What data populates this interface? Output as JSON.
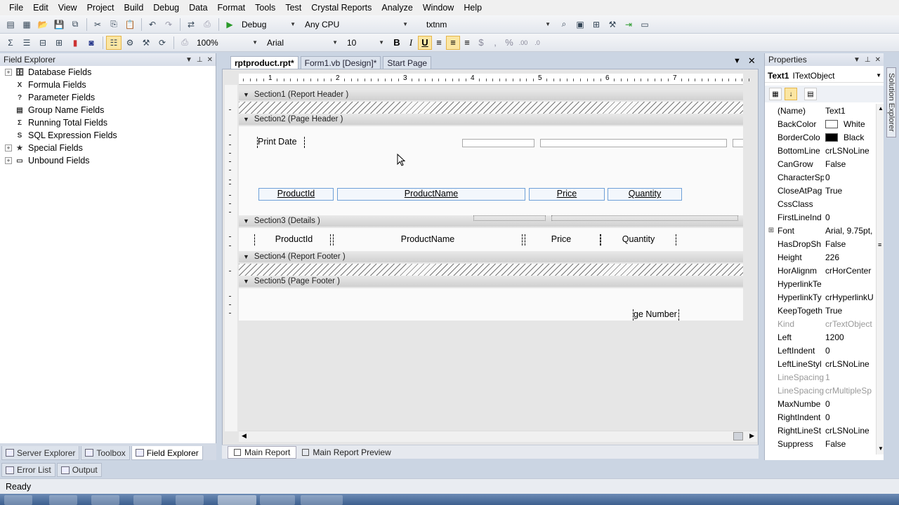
{
  "menu": [
    "File",
    "Edit",
    "View",
    "Project",
    "Build",
    "Debug",
    "Data",
    "Format",
    "Tools",
    "Test",
    "Crystal Reports",
    "Analyze",
    "Window",
    "Help"
  ],
  "toolbar1": {
    "config": "Debug",
    "platform": "Any CPU",
    "find": "txtnm"
  },
  "toolbar2": {
    "zoom": "100%",
    "font": "Arial",
    "size": "10",
    "bold": "B",
    "italic": "I",
    "underline": "U"
  },
  "field_explorer": {
    "title": "Field Explorer",
    "items": [
      {
        "label": "Database Fields",
        "expandable": true,
        "icon": "database-icon"
      },
      {
        "label": "Formula Fields",
        "expandable": false,
        "icon": "formula-icon"
      },
      {
        "label": "Parameter Fields",
        "expandable": false,
        "icon": "parameter-icon"
      },
      {
        "label": "Group Name Fields",
        "expandable": false,
        "icon": "group-icon"
      },
      {
        "label": "Running Total Fields",
        "expandable": false,
        "icon": "sigma-icon"
      },
      {
        "label": "SQL Expression Fields",
        "expandable": false,
        "icon": "sql-icon"
      },
      {
        "label": "Special Fields",
        "expandable": true,
        "icon": "special-icon"
      },
      {
        "label": "Unbound Fields",
        "expandable": true,
        "icon": "unbound-icon"
      }
    ]
  },
  "left_tabs": [
    "Server Explorer",
    "Toolbox",
    "Field Explorer"
  ],
  "bottom_tabs": [
    "Error List",
    "Output"
  ],
  "doc_tabs": [
    "rptproduct.rpt*",
    "Form1.vb [Design]*",
    "Start Page"
  ],
  "ruler": [
    "1",
    "2",
    "3",
    "4",
    "5",
    "6",
    "7"
  ],
  "sections": {
    "s1": "Section1 (Report Header  )",
    "s2": "Section2 (Page Header  )",
    "s3": "Section3 (Details  )",
    "s4": "Section4 (Report Footer  )",
    "s5": "Section5 (Page Footer  )"
  },
  "report": {
    "print_date": "Print Date",
    "headers": [
      "ProductId",
      "ProductName",
      "Price",
      "Quantity"
    ],
    "details": [
      "ProductId",
      "ProductName",
      "Price",
      "Quantity"
    ],
    "page_number": "ge Number"
  },
  "report_tabs": [
    "Main Report",
    "Main Report Preview"
  ],
  "properties": {
    "title": "Properties",
    "object_name": "Text1",
    "object_type": "ITextObject",
    "rows": [
      {
        "name": "(Name)",
        "value": "Text1"
      },
      {
        "name": "BackColor",
        "value": "White",
        "swatch": "#ffffff"
      },
      {
        "name": "BorderColo",
        "value": "Black",
        "swatch": "#000000"
      },
      {
        "name": "BottomLine",
        "value": "crLSNoLine"
      },
      {
        "name": "CanGrow",
        "value": "False"
      },
      {
        "name": "CharacterSp",
        "value": "0"
      },
      {
        "name": "CloseAtPag",
        "value": "True"
      },
      {
        "name": "CssClass",
        "value": ""
      },
      {
        "name": "FirstLineInd",
        "value": "0"
      },
      {
        "name": "Font",
        "value": "Arial, 9.75pt,",
        "expandable": true
      },
      {
        "name": "HasDropSh",
        "value": "False"
      },
      {
        "name": "Height",
        "value": "226"
      },
      {
        "name": "HorAlignm",
        "value": "crHorCenter"
      },
      {
        "name": "HyperlinkTe",
        "value": ""
      },
      {
        "name": "HyperlinkTy",
        "value": "crHyperlinkU"
      },
      {
        "name": "KeepTogeth",
        "value": "True"
      },
      {
        "name": "Kind",
        "value": "crTextObject",
        "dim": true
      },
      {
        "name": "Left",
        "value": "1200"
      },
      {
        "name": "LeftIndent",
        "value": "0"
      },
      {
        "name": "LeftLineStyl",
        "value": "crLSNoLine"
      },
      {
        "name": "LineSpacing",
        "value": "1",
        "dim": true
      },
      {
        "name": "LineSpacing",
        "value": "crMultipleSp",
        "dim": true
      },
      {
        "name": "MaxNumbe",
        "value": "0"
      },
      {
        "name": "RightIndent",
        "value": "0"
      },
      {
        "name": "RightLineSt",
        "value": "crLSNoLine"
      },
      {
        "name": "Suppress",
        "value": "False"
      }
    ]
  },
  "side_tab": "Solution Explorer",
  "status": "Ready"
}
